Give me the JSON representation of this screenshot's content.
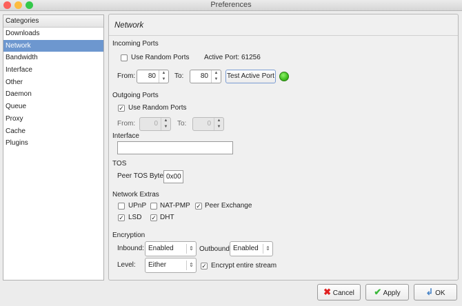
{
  "window": {
    "title": "Preferences"
  },
  "categories": {
    "header": "Categories",
    "items": [
      "Downloads",
      "Network",
      "Bandwidth",
      "Interface",
      "Other",
      "Daemon",
      "Queue",
      "Proxy",
      "Cache",
      "Plugins"
    ],
    "selected": "Network"
  },
  "page": {
    "title": "Network"
  },
  "incoming": {
    "label": "Incoming Ports",
    "random_label": "Use Random Ports",
    "random_checked": false,
    "active_port_label": "Active Port:",
    "active_port": "61256",
    "from_label": "From:",
    "from": "80",
    "to_label": "To:",
    "to": "80",
    "test_label": "Test Active Port",
    "status_color": "#3fbf1f"
  },
  "outgoing": {
    "label": "Outgoing Ports",
    "random_label": "Use Random Ports",
    "random_checked": true,
    "from_label": "From:",
    "from": "0",
    "to_label": "To:",
    "to": "0"
  },
  "interface": {
    "label": "Interface",
    "value": ""
  },
  "tos": {
    "label": "TOS",
    "byte_label": "Peer TOS Byte:",
    "byte": "0x00"
  },
  "extras": {
    "label": "Network Extras",
    "upnp": "UPnP",
    "natpmp": "NAT-PMP",
    "pex": "Peer Exchange",
    "lsd": "LSD",
    "dht": "DHT"
  },
  "encryption": {
    "label": "Encryption",
    "inbound_label": "Inbound:",
    "inbound": "Enabled",
    "outbound_label": "Outbound:",
    "outbound": "Enabled",
    "level_label": "Level:",
    "level": "Either",
    "entire_label": "Encrypt entire stream"
  },
  "buttons": {
    "cancel": "Cancel",
    "apply": "Apply",
    "ok": "OK"
  },
  "check": "✓"
}
